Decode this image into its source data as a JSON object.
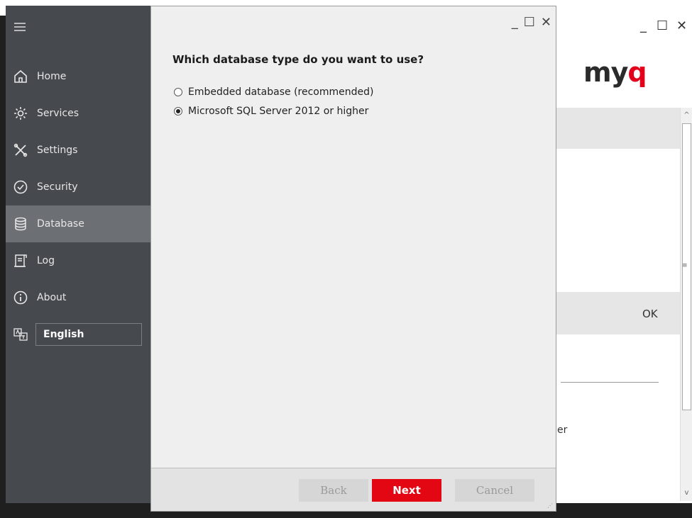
{
  "background_window": {
    "window_controls": {
      "minimize": "_",
      "maximize": "☐",
      "close": "✕"
    },
    "logo": {
      "text_main": "my",
      "text_accent": "q"
    },
    "ok_label": "OK",
    "partial_text": "er",
    "scroll_up": "^",
    "scroll_down": "v",
    "scroll_grip": "≡"
  },
  "sidebar": {
    "items": [
      {
        "label": "Home",
        "icon": "home-icon"
      },
      {
        "label": "Services",
        "icon": "gear-icon"
      },
      {
        "label": "Settings",
        "icon": "tools-icon"
      },
      {
        "label": "Security",
        "icon": "shield-icon"
      },
      {
        "label": "Database",
        "icon": "database-icon",
        "active": true
      },
      {
        "label": "Log",
        "icon": "log-icon"
      },
      {
        "label": "About",
        "icon": "info-icon"
      }
    ],
    "language": {
      "icon": "language-icon",
      "selected": "English"
    }
  },
  "dialog": {
    "window_controls": {
      "minimize": "_",
      "maximize": "☐",
      "close": "✕"
    },
    "question": "Which database type do you want to use?",
    "options": [
      {
        "label": "Embedded database (recommended)",
        "checked": false
      },
      {
        "label": "Microsoft SQL Server 2012 or higher",
        "checked": true
      }
    ],
    "buttons": {
      "back": "Back",
      "next": "Next",
      "cancel": "Cancel"
    }
  },
  "colors": {
    "accent": "#e30613",
    "sidebar_bg": "#464a4f",
    "sidebar_active": "#6c7075"
  }
}
